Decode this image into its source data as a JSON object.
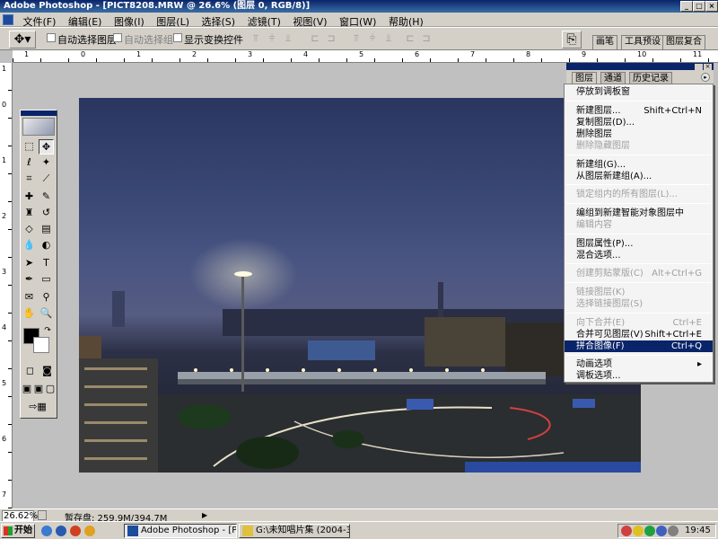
{
  "window": {
    "title": "Adobe Photoshop - [PICT8208.MRW @ 26.6% (图层 0, RGB/8)]",
    "controls": [
      "_",
      "□",
      "×"
    ]
  },
  "menubar": [
    "文件(F)",
    "编辑(E)",
    "图像(I)",
    "图层(L)",
    "选择(S)",
    "滤镜(T)",
    "视图(V)",
    "窗口(W)",
    "帮助(H)"
  ],
  "options": {
    "auto_select_layer": "自动选择图层",
    "auto_select_group": "自动选择组",
    "show_transform": "显示变换控件"
  },
  "wells": [
    "画笔",
    "工具预设",
    "图层复合"
  ],
  "ruler_h": [
    "1",
    "0",
    "1",
    "2",
    "3",
    "4",
    "5",
    "6",
    "7",
    "8",
    "9",
    "10",
    "11"
  ],
  "ruler_v": [
    "1",
    "0",
    "1",
    "2",
    "3",
    "4",
    "5",
    "6",
    "7"
  ],
  "panel": {
    "tabs": [
      "图层",
      "通道",
      "历史记录"
    ]
  },
  "context_menu": [
    {
      "label": "停放到调板窗",
      "shortcut": "",
      "disabled": false
    },
    {
      "label": "新建图层...",
      "shortcut": "Shift+Ctrl+N",
      "disabled": false
    },
    {
      "label": "复制图层(D)...",
      "shortcut": "",
      "disabled": false
    },
    {
      "label": "删除图层",
      "shortcut": "",
      "disabled": false
    },
    {
      "label": "删除隐藏图层",
      "shortcut": "",
      "disabled": true
    },
    {
      "label": "新建组(G)...",
      "shortcut": "",
      "disabled": false
    },
    {
      "label": "从图层新建组(A)...",
      "shortcut": "",
      "disabled": false
    },
    {
      "label": "锁定组内的所有图层(L)...",
      "shortcut": "",
      "disabled": true
    },
    {
      "label": "编组到新建智能对象图层中",
      "shortcut": "",
      "disabled": false
    },
    {
      "label": "编辑内容",
      "shortcut": "",
      "disabled": true
    },
    {
      "label": "图层属性(P)...",
      "shortcut": "",
      "disabled": false
    },
    {
      "label": "混合选项...",
      "shortcut": "",
      "disabled": false
    },
    {
      "label": "创建剪贴蒙版(C)",
      "shortcut": "Alt+Ctrl+G",
      "disabled": true
    },
    {
      "label": "链接图层(K)",
      "shortcut": "",
      "disabled": true
    },
    {
      "label": "选择链接图层(S)",
      "shortcut": "",
      "disabled": true
    },
    {
      "label": "向下合并(E)",
      "shortcut": "Ctrl+E",
      "disabled": true
    },
    {
      "label": "合并可见图层(V)",
      "shortcut": "Shift+Ctrl+E",
      "disabled": false
    },
    {
      "label": "拼合图像(F)",
      "shortcut": "Ctrl+Q",
      "disabled": false,
      "highlighted": true
    },
    {
      "label": "动画选项",
      "shortcut": "▸",
      "disabled": false
    },
    {
      "label": "调板选项...",
      "shortcut": "",
      "disabled": false
    }
  ],
  "status": {
    "zoom": "26.62%",
    "scratch": "暂存盘: 259.9M/394.7M"
  },
  "taskbar": {
    "start": "开始",
    "tasks": [
      "Adobe Photoshop - [PIC...",
      "G:\\未知唱片集 (2004-3-..."
    ],
    "clock": "19:45"
  }
}
